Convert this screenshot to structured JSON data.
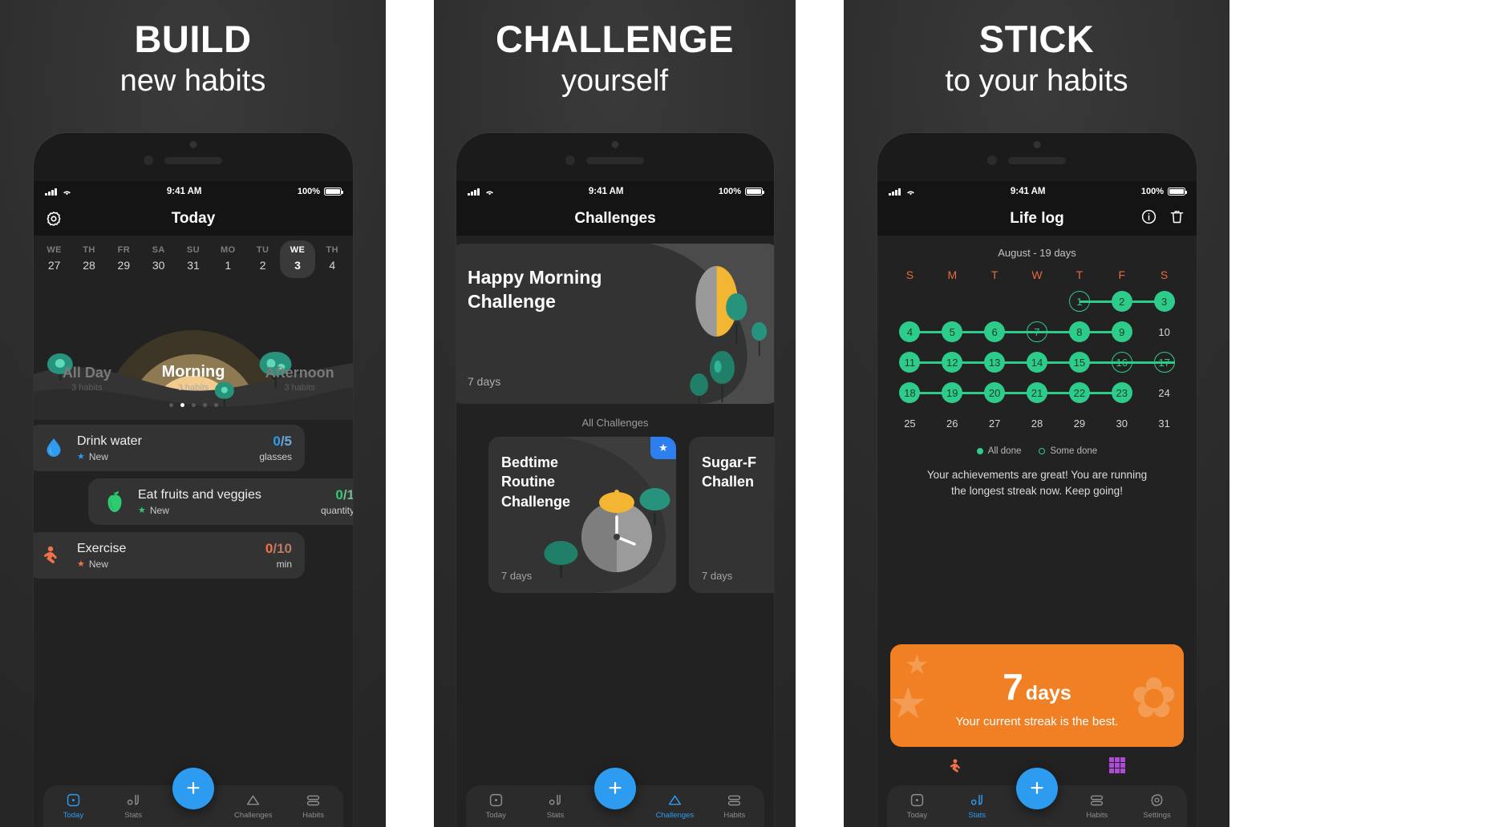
{
  "panels": [
    {
      "headline_big": "BUILD",
      "headline_sub": "new habits",
      "status": {
        "time": "9:41 AM",
        "battery": "100%"
      },
      "nav_title": "Today",
      "week": [
        {
          "dw": "WE",
          "dn": "27"
        },
        {
          "dw": "TH",
          "dn": "28"
        },
        {
          "dw": "FR",
          "dn": "29"
        },
        {
          "dw": "SA",
          "dn": "30"
        },
        {
          "dw": "SU",
          "dn": "31"
        },
        {
          "dw": "MO",
          "dn": "1"
        },
        {
          "dw": "TU",
          "dn": "2"
        },
        {
          "dw": "WE",
          "dn": "3"
        },
        {
          "dw": "TH",
          "dn": "4"
        }
      ],
      "segments": [
        {
          "name": "All Day",
          "count": "3 habits"
        },
        {
          "name": "Morning",
          "count": "3 habits"
        },
        {
          "name": "Afternoon",
          "count": "3 habits"
        }
      ],
      "habits": [
        {
          "name": "Drink water",
          "tag": "New",
          "value": "0",
          "total": "/5",
          "unit": "glasses",
          "color": "#2d9cf0"
        },
        {
          "name": "Eat fruits and veggies",
          "tag": "New",
          "value": "0",
          "total": "/1",
          "unit": "quantity",
          "color": "#2ecc71"
        },
        {
          "name": "Exercise",
          "tag": "New",
          "value": "0",
          "total": "/10",
          "unit": "min",
          "color": "#f4724a"
        }
      ],
      "tabs": [
        {
          "label": "Today",
          "active": true
        },
        {
          "label": "Stats",
          "active": false
        },
        {
          "label": "Challenges",
          "active": false
        },
        {
          "label": "Habits",
          "active": false
        }
      ],
      "fab_label": "+"
    },
    {
      "headline_big": "CHALLENGE",
      "headline_sub": "yourself",
      "status": {
        "time": "9:41 AM",
        "battery": "100%"
      },
      "nav_title": "Challenges",
      "featured": {
        "title": "Happy Morning\nChallenge",
        "days": "7 days"
      },
      "all_label": "All Challenges",
      "cards": [
        {
          "title": "Bedtime\nRoutine\nChallenge",
          "days": "7 days",
          "starred": true
        },
        {
          "title": "Sugar-F\nChallen",
          "days": "7 days",
          "starred": false
        }
      ],
      "tabs": [
        {
          "label": "Today",
          "active": false
        },
        {
          "label": "Stats",
          "active": false
        },
        {
          "label": "Challenges",
          "active": true
        },
        {
          "label": "Habits",
          "active": false
        }
      ],
      "fab_label": "+"
    },
    {
      "headline_big": "STICK",
      "headline_sub": "to your habits",
      "status": {
        "time": "9:41 AM",
        "battery": "100%"
      },
      "nav_title": "Life log",
      "month": "August - 19 days",
      "weekday_letters": [
        "S",
        "M",
        "T",
        "W",
        "T",
        "F",
        "S"
      ],
      "calendar": [
        [
          null,
          null,
          null,
          null,
          {
            "n": "1",
            "s": "partial"
          },
          {
            "n": "2",
            "s": "done"
          },
          {
            "n": "3",
            "s": "done"
          }
        ],
        [
          {
            "n": "4",
            "s": "done"
          },
          {
            "n": "5",
            "s": "done"
          },
          {
            "n": "6",
            "s": "done"
          },
          {
            "n": "7",
            "s": "partial"
          },
          {
            "n": "8",
            "s": "done"
          },
          {
            "n": "9",
            "s": "done"
          },
          {
            "n": "10",
            "s": "none"
          }
        ],
        [
          {
            "n": "11",
            "s": "done"
          },
          {
            "n": "12",
            "s": "done"
          },
          {
            "n": "13",
            "s": "done"
          },
          {
            "n": "14",
            "s": "done"
          },
          {
            "n": "15",
            "s": "done"
          },
          {
            "n": "16",
            "s": "partial"
          },
          {
            "n": "17",
            "s": "partial"
          }
        ],
        [
          {
            "n": "18",
            "s": "done"
          },
          {
            "n": "19",
            "s": "done"
          },
          {
            "n": "20",
            "s": "done"
          },
          {
            "n": "21",
            "s": "done"
          },
          {
            "n": "22",
            "s": "done"
          },
          {
            "n": "23",
            "s": "done"
          },
          {
            "n": "24",
            "s": "none"
          }
        ],
        [
          {
            "n": "25",
            "s": "none"
          },
          {
            "n": "26",
            "s": "none"
          },
          {
            "n": "27",
            "s": "none"
          },
          {
            "n": "28",
            "s": "none"
          },
          {
            "n": "29",
            "s": "none"
          },
          {
            "n": "30",
            "s": "none"
          },
          {
            "n": "31",
            "s": "none"
          }
        ]
      ],
      "legend": [
        {
          "label": "All done",
          "style": "solid"
        },
        {
          "label": "Some done",
          "style": "hollow"
        }
      ],
      "achievement": "Your achievements are great! You are running\nthe longest streak now. Keep going!",
      "streak": {
        "number": "7",
        "unit": "days",
        "desc": "Your current streak is the best."
      },
      "tabs": [
        {
          "label": "Today",
          "active": false
        },
        {
          "label": "Stats",
          "active": true
        },
        {
          "label": "Habits",
          "active": false
        },
        {
          "label": "Settings",
          "active": false
        }
      ],
      "fab_label": "+",
      "accent": "#f08023"
    }
  ]
}
